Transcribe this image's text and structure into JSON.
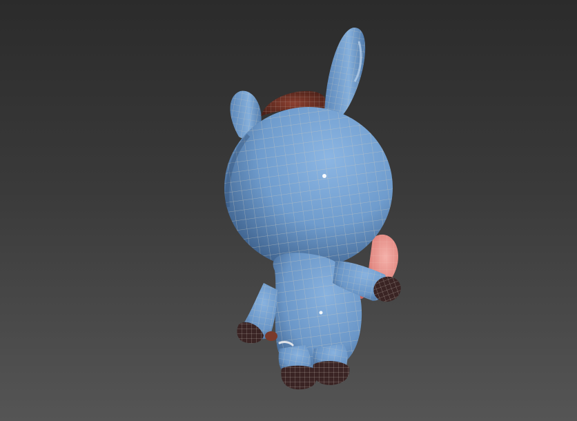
{
  "viewport": {
    "view_type": "perspective-3d",
    "shading": "smooth-with-wireframe-edges",
    "background_gradient": [
      "#2b2b2b",
      "#555555"
    ]
  },
  "model": {
    "subject": "cartoon-donkey",
    "colors": {
      "body": "#6f9ccd",
      "body_shadow": "#3f6592",
      "wire_light": "#c9c5b8",
      "hooves": "#3a2424",
      "hair_tuft": "#7a3a2c",
      "muzzle": "#e8938c",
      "inner_mouth": "#c7645e"
    }
  }
}
